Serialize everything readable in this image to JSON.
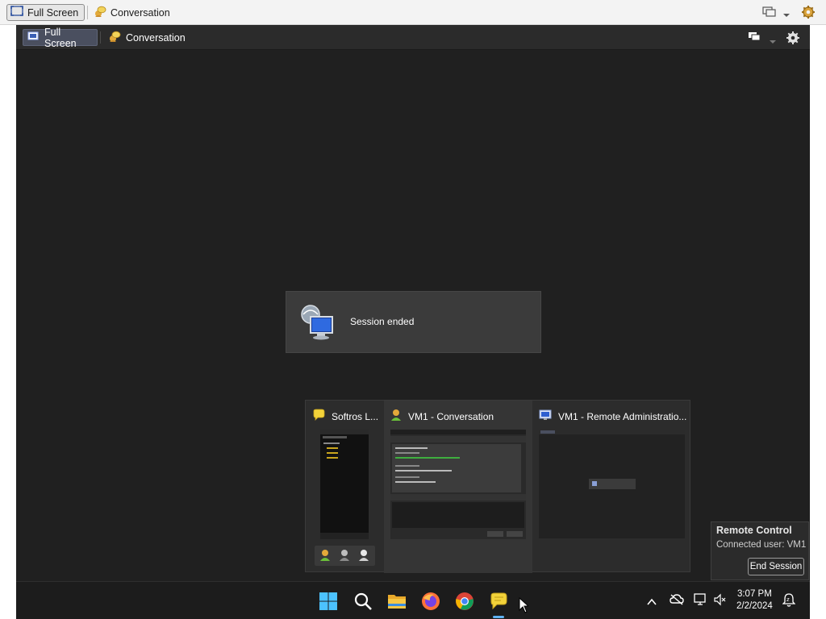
{
  "outer_toolbar": {
    "full_screen_label": "Full Screen",
    "conversation_label": "Conversation",
    "icons": [
      "fullscreen-icon",
      "conversation-icon",
      "monitor-switch-icon",
      "dropdown-arrow-icon",
      "settings-gear-icon"
    ]
  },
  "remote_toolbar": {
    "full_screen_label": "Full Screen",
    "conversation_label": "Conversation"
  },
  "session_popup": {
    "message": "Session ended"
  },
  "thumbnails": [
    {
      "title": "Softros L...",
      "icon": "chat-bubble-icon"
    },
    {
      "title": "VM1 - Conversation",
      "icon": "user-icon"
    },
    {
      "title": "VM1 - Remote Administratio...",
      "icon": "remote-admin-icon"
    }
  ],
  "remote_control": {
    "title": "Remote Control",
    "connected_user": "Connected user: VM1",
    "end_session_label": "End Session"
  },
  "taskbar": {
    "apps": [
      "start-icon",
      "search-icon",
      "file-explorer-icon",
      "firefox-icon",
      "chrome-icon",
      "softros-messenger-icon"
    ],
    "time": "3:07 PM",
    "date": "2/2/2024"
  },
  "colors": {
    "remote_bg": "#202020",
    "accent": "#5fb2f2"
  }
}
